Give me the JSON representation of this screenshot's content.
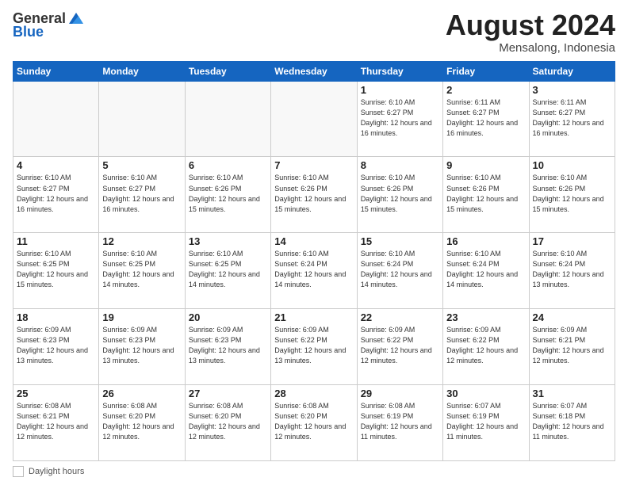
{
  "header": {
    "logo_general": "General",
    "logo_blue": "Blue",
    "title": "August 2024",
    "location": "Mensalong, Indonesia"
  },
  "calendar": {
    "days_of_week": [
      "Sunday",
      "Monday",
      "Tuesday",
      "Wednesday",
      "Thursday",
      "Friday",
      "Saturday"
    ],
    "weeks": [
      [
        {
          "day": "",
          "info": ""
        },
        {
          "day": "",
          "info": ""
        },
        {
          "day": "",
          "info": ""
        },
        {
          "day": "",
          "info": ""
        },
        {
          "day": "1",
          "info": "Sunrise: 6:10 AM\nSunset: 6:27 PM\nDaylight: 12 hours\nand 16 minutes."
        },
        {
          "day": "2",
          "info": "Sunrise: 6:11 AM\nSunset: 6:27 PM\nDaylight: 12 hours\nand 16 minutes."
        },
        {
          "day": "3",
          "info": "Sunrise: 6:11 AM\nSunset: 6:27 PM\nDaylight: 12 hours\nand 16 minutes."
        }
      ],
      [
        {
          "day": "4",
          "info": "Sunrise: 6:10 AM\nSunset: 6:27 PM\nDaylight: 12 hours\nand 16 minutes."
        },
        {
          "day": "5",
          "info": "Sunrise: 6:10 AM\nSunset: 6:27 PM\nDaylight: 12 hours\nand 16 minutes."
        },
        {
          "day": "6",
          "info": "Sunrise: 6:10 AM\nSunset: 6:26 PM\nDaylight: 12 hours\nand 15 minutes."
        },
        {
          "day": "7",
          "info": "Sunrise: 6:10 AM\nSunset: 6:26 PM\nDaylight: 12 hours\nand 15 minutes."
        },
        {
          "day": "8",
          "info": "Sunrise: 6:10 AM\nSunset: 6:26 PM\nDaylight: 12 hours\nand 15 minutes."
        },
        {
          "day": "9",
          "info": "Sunrise: 6:10 AM\nSunset: 6:26 PM\nDaylight: 12 hours\nand 15 minutes."
        },
        {
          "day": "10",
          "info": "Sunrise: 6:10 AM\nSunset: 6:26 PM\nDaylight: 12 hours\nand 15 minutes."
        }
      ],
      [
        {
          "day": "11",
          "info": "Sunrise: 6:10 AM\nSunset: 6:25 PM\nDaylight: 12 hours\nand 15 minutes."
        },
        {
          "day": "12",
          "info": "Sunrise: 6:10 AM\nSunset: 6:25 PM\nDaylight: 12 hours\nand 14 minutes."
        },
        {
          "day": "13",
          "info": "Sunrise: 6:10 AM\nSunset: 6:25 PM\nDaylight: 12 hours\nand 14 minutes."
        },
        {
          "day": "14",
          "info": "Sunrise: 6:10 AM\nSunset: 6:24 PM\nDaylight: 12 hours\nand 14 minutes."
        },
        {
          "day": "15",
          "info": "Sunrise: 6:10 AM\nSunset: 6:24 PM\nDaylight: 12 hours\nand 14 minutes."
        },
        {
          "day": "16",
          "info": "Sunrise: 6:10 AM\nSunset: 6:24 PM\nDaylight: 12 hours\nand 14 minutes."
        },
        {
          "day": "17",
          "info": "Sunrise: 6:10 AM\nSunset: 6:24 PM\nDaylight: 12 hours\nand 13 minutes."
        }
      ],
      [
        {
          "day": "18",
          "info": "Sunrise: 6:09 AM\nSunset: 6:23 PM\nDaylight: 12 hours\nand 13 minutes."
        },
        {
          "day": "19",
          "info": "Sunrise: 6:09 AM\nSunset: 6:23 PM\nDaylight: 12 hours\nand 13 minutes."
        },
        {
          "day": "20",
          "info": "Sunrise: 6:09 AM\nSunset: 6:23 PM\nDaylight: 12 hours\nand 13 minutes."
        },
        {
          "day": "21",
          "info": "Sunrise: 6:09 AM\nSunset: 6:22 PM\nDaylight: 12 hours\nand 13 minutes."
        },
        {
          "day": "22",
          "info": "Sunrise: 6:09 AM\nSunset: 6:22 PM\nDaylight: 12 hours\nand 12 minutes."
        },
        {
          "day": "23",
          "info": "Sunrise: 6:09 AM\nSunset: 6:22 PM\nDaylight: 12 hours\nand 12 minutes."
        },
        {
          "day": "24",
          "info": "Sunrise: 6:09 AM\nSunset: 6:21 PM\nDaylight: 12 hours\nand 12 minutes."
        }
      ],
      [
        {
          "day": "25",
          "info": "Sunrise: 6:08 AM\nSunset: 6:21 PM\nDaylight: 12 hours\nand 12 minutes."
        },
        {
          "day": "26",
          "info": "Sunrise: 6:08 AM\nSunset: 6:20 PM\nDaylight: 12 hours\nand 12 minutes."
        },
        {
          "day": "27",
          "info": "Sunrise: 6:08 AM\nSunset: 6:20 PM\nDaylight: 12 hours\nand 12 minutes."
        },
        {
          "day": "28",
          "info": "Sunrise: 6:08 AM\nSunset: 6:20 PM\nDaylight: 12 hours\nand 12 minutes."
        },
        {
          "day": "29",
          "info": "Sunrise: 6:08 AM\nSunset: 6:19 PM\nDaylight: 12 hours\nand 11 minutes."
        },
        {
          "day": "30",
          "info": "Sunrise: 6:07 AM\nSunset: 6:19 PM\nDaylight: 12 hours\nand 11 minutes."
        },
        {
          "day": "31",
          "info": "Sunrise: 6:07 AM\nSunset: 6:18 PM\nDaylight: 12 hours\nand 11 minutes."
        }
      ]
    ]
  },
  "footer": {
    "label": "Daylight hours"
  }
}
